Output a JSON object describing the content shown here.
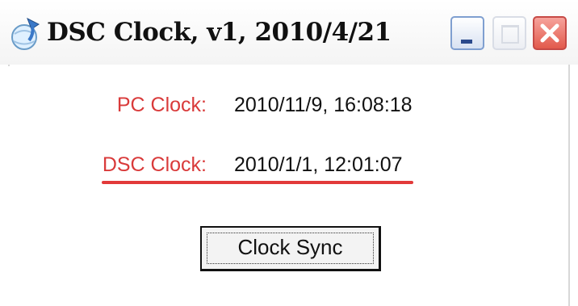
{
  "window": {
    "title": "DSC Clock, v1, 2010/4/21",
    "icon": "globe-arrow-icon",
    "controls": {
      "minimize": "minimize-icon",
      "maximize": "maximize-icon",
      "close": "close-icon"
    }
  },
  "clocks": {
    "pc_label": "PC Clock:",
    "pc_value": "2010/11/9, 16:08:18",
    "dsc_label": "DSC Clock:",
    "dsc_value": "2010/1/1, 12:01:07"
  },
  "actions": {
    "sync_label": "Clock Sync"
  },
  "colors": {
    "label": "#d93a3a",
    "underline": "#e23a3a",
    "close_button": "#e25a4c"
  }
}
